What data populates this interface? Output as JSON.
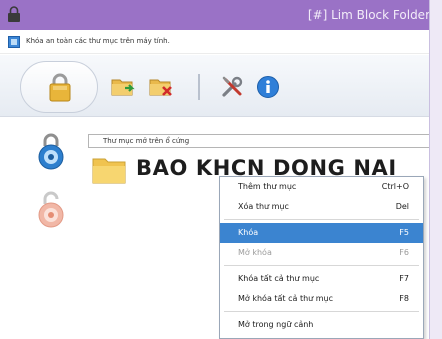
{
  "window": {
    "title": "[#] Lim Block Folder"
  },
  "subtitle": {
    "text": "Khóa an toàn các thư mục trên máy tính."
  },
  "toolbar": {
    "buttons": [
      {
        "icon": "lock-icon"
      },
      {
        "icon": "folder-add-icon"
      },
      {
        "icon": "folder-remove-icon"
      },
      {
        "icon": "tools-icon"
      },
      {
        "icon": "info-icon"
      }
    ]
  },
  "path_field": {
    "value": "Thư mục mở trên ổ cứng"
  },
  "folder": {
    "name": "BAO KHCN DONG NAI"
  },
  "context_menu": {
    "items": [
      {
        "label": "Thêm thư mục",
        "shortcut": "Ctrl+O",
        "state": "normal"
      },
      {
        "label": "Xóa thư mục",
        "shortcut": "Del",
        "state": "normal"
      },
      {
        "label": "Khóa",
        "shortcut": "F5",
        "state": "selected"
      },
      {
        "label": "Mở khóa",
        "shortcut": "F6",
        "state": "disabled"
      },
      {
        "label": "Khóa tất cả thư mục",
        "shortcut": "F7",
        "state": "normal"
      },
      {
        "label": "Mở khóa tất cả thư mục",
        "shortcut": "F8",
        "state": "normal"
      },
      {
        "label": "Mở trong ngữ cảnh",
        "shortcut": "",
        "state": "normal"
      }
    ]
  },
  "colors": {
    "titlebar": "#9a72c6",
    "selection": "#3b84d0",
    "info_icon": "#2f7fd8"
  }
}
